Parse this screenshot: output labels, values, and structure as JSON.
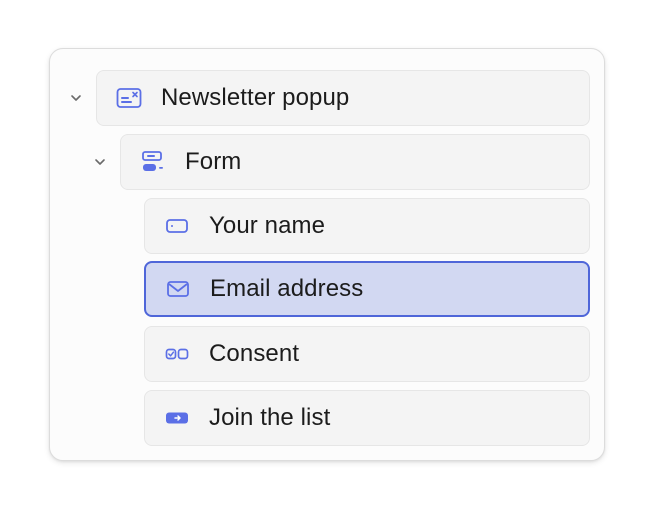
{
  "tree": {
    "colors": {
      "icon": "#5b6fe6",
      "selected_bg": "#d2d8f2",
      "selected_border": "#4f66d9"
    },
    "nodes": [
      {
        "label": "Newsletter popup",
        "icon": "popup-icon",
        "expanded": true,
        "selected": false
      },
      {
        "label": "Form",
        "icon": "form-icon",
        "expanded": true,
        "selected": false
      },
      {
        "label": "Your name",
        "icon": "text-input-icon",
        "selected": false
      },
      {
        "label": "Email address",
        "icon": "email-icon",
        "selected": true
      },
      {
        "label": "Consent",
        "icon": "checkbox-icon",
        "selected": false
      },
      {
        "label": "Join the list",
        "icon": "button-icon",
        "selected": false
      }
    ]
  }
}
